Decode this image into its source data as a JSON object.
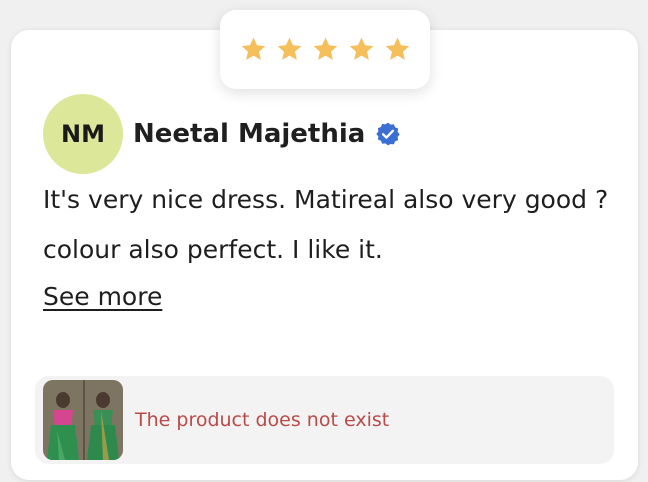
{
  "rating": {
    "stars": 5,
    "max_stars": 5,
    "star_color": "#f5bf5b"
  },
  "author": {
    "initials": "NM",
    "name": "Neetal Majethia",
    "avatar_color": "#dde79a",
    "verified": true,
    "verified_color": "#3b6fd4"
  },
  "review": {
    "text": "It's very nice dress. Matireal also very good ? colour also perfect. I like it.",
    "see_more_label": "See more"
  },
  "product": {
    "message": "The product does not exist",
    "message_color": "#b94a48"
  }
}
